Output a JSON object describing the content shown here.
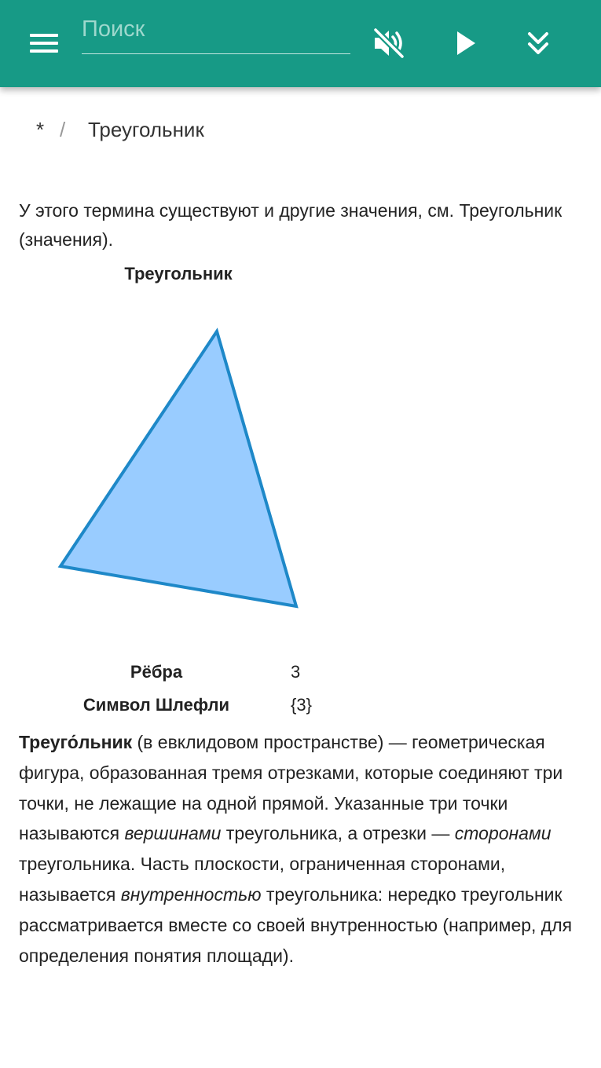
{
  "toolbar": {
    "search_placeholder": "Поиск",
    "menu_icon": "hamburger-menu-icon",
    "mute_icon": "volume-off-icon",
    "play_icon": "play-icon",
    "expand_icon": "double-chevron-down-icon",
    "accent_color": "#179a86"
  },
  "breadcrumb": {
    "home": "*",
    "separator": "/",
    "current": "Треугольник"
  },
  "hatnote": {
    "text": "У этого термина существуют и другие значения, см. ",
    "link": "Треугольник (значения)",
    "end": "."
  },
  "infobox": {
    "title": "Треугольник",
    "image_fill": "#99ccff",
    "image_stroke": "#1e88c8",
    "rows": [
      {
        "label": "Рёбра",
        "value": "3"
      },
      {
        "label": "Символ Шлефли",
        "value": "{3}"
      }
    ]
  },
  "article": {
    "term": "Треуго́льник",
    "s1": " (в евклидовом пространстве) — геометрическая фигура, образованная тремя отрезками, которые соединяют три точки, не лежащие на одной прямой. Указанные три точки называются ",
    "em1": "вершинами",
    "s2": " треугольника, а отрезки — ",
    "em2": "сторонами",
    "s3": " треугольника. Часть плоскости, ограниченная сторонами, называется ",
    "em3": "внутренностью",
    "s4": " треугольника: нередко треугольник рассматривается вместе со своей внутренностью (например, для определения понятия площади)."
  }
}
